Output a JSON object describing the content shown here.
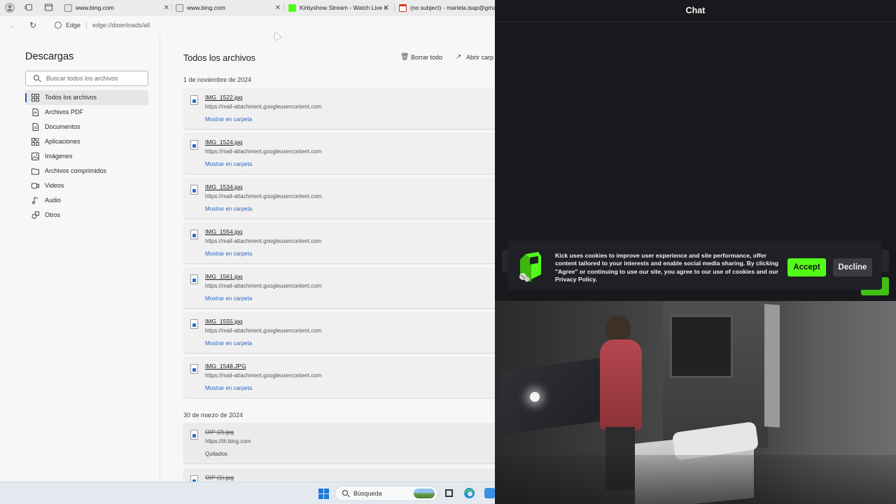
{
  "browser": {
    "tabs": [
      {
        "title": "www.bing.com",
        "favicon_color": "#4a4a4a"
      },
      {
        "title": "www.bing.com",
        "favicon_color": "#4a4a4a"
      },
      {
        "title": "Kirbyshow Stream - Watch Live o",
        "favicon_color": "#53fc18"
      },
      {
        "title": "(no subject) - mariela.isap@gmail",
        "favicon_color": "#d93025"
      }
    ],
    "address": {
      "site": "Edge",
      "url": "edge://downloads/all"
    }
  },
  "sidebar": {
    "title": "Descargas",
    "search_placeholder": "Buscar todos los archivos",
    "items": [
      {
        "label": "Todos los archivos",
        "icon": "grid-icon",
        "active": true
      },
      {
        "label": "Archivos PDF",
        "icon": "pdf-icon"
      },
      {
        "label": "Documentos",
        "icon": "document-icon"
      },
      {
        "label": "Aplicaciones",
        "icon": "apps-icon"
      },
      {
        "label": "Imágenes",
        "icon": "image-icon"
      },
      {
        "label": "Archivos comprimidos",
        "icon": "archive-icon"
      },
      {
        "label": "Videos",
        "icon": "video-icon"
      },
      {
        "label": "Audio",
        "icon": "music-icon"
      },
      {
        "label": "Otros",
        "icon": "shapes-icon"
      }
    ]
  },
  "main": {
    "title": "Todos los archivos",
    "clear_all": "Borrar todo",
    "open_folder": "Abrir carp",
    "groups": [
      {
        "date": "1 de noviembre de 2024",
        "files": [
          {
            "name": "IMG_1522.jpg",
            "source": "https://mail-attachment.googleusercontent.com",
            "action": "Mostrar en carpeta"
          },
          {
            "name": "IMG_1524.jpg",
            "source": "https://mail-attachment.googleusercontent.com",
            "action": "Mostrar en carpeta"
          },
          {
            "name": "IMG_1534.jpg",
            "source": "https://mail-attachment.googleusercontent.com",
            "action": "Mostrar en carpeta"
          },
          {
            "name": "IMG_1554.jpg",
            "source": "https://mail-attachment.googleusercontent.com",
            "action": "Mostrar en carpeta"
          },
          {
            "name": "IMG_1561.jpg",
            "source": "https://mail-attachment.googleusercontent.com",
            "action": "Mostrar en carpeta"
          },
          {
            "name": "IMG_1555.jpg",
            "source": "https://mail-attachment.googleusercontent.com",
            "action": "Mostrar en carpeta"
          },
          {
            "name": "IMG_1548.JPG",
            "source": "https://mail-attachment.googleusercontent.com",
            "action": "Mostrar en carpeta"
          }
        ]
      },
      {
        "date": "30 de marzo de 2024",
        "files": [
          {
            "name": "OIP (2).jpg",
            "source": "https://th.bing.com",
            "action": "Quitados",
            "removed": true
          },
          {
            "name": "OIP (1).jpg",
            "source": "",
            "action": "",
            "removed": true
          }
        ]
      }
    ]
  },
  "taskbar": {
    "search_label": "Búsqueda"
  },
  "kick": {
    "chat_title": "Chat",
    "cookie_message": "Kick uses cookies to improve user experience and site performance, offer content tailored to your interests and enable social media sharing. By clicking \"Agree\" or continuing to use our site, you agree to our use of cookies and our Privacy Policy.",
    "accept_label": "Accept",
    "decline_label": "Decline",
    "accent_color": "#53fc18"
  }
}
